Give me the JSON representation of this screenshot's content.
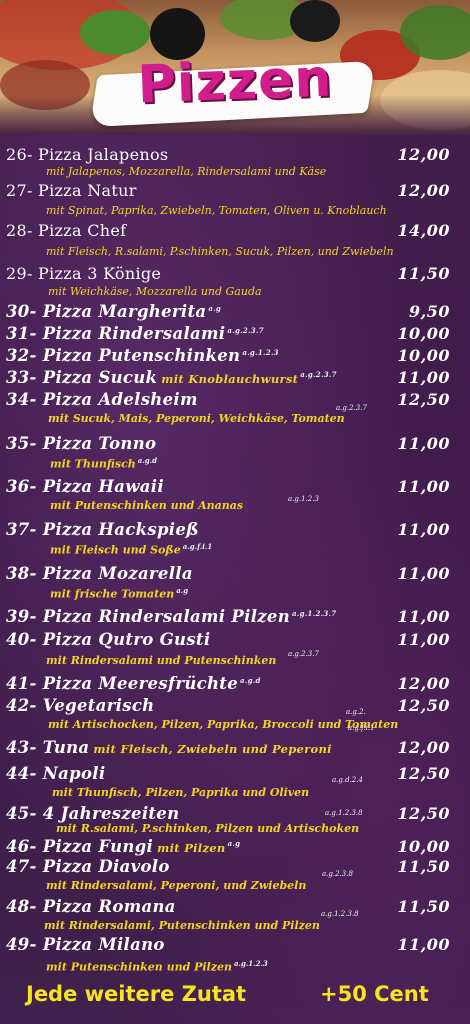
{
  "header": {
    "title": "Pizzen"
  },
  "items": [
    {
      "name": "26- Pizza Jalapenos",
      "price": "12,00",
      "desc": "mit Jalapenos, Mozzarella, Rindersalami und Käse"
    },
    {
      "name": "27- Pizza Natur",
      "price": "12,00",
      "desc": "mit Spinat, Paprika, Zwiebeln, Tomaten, Oliven u. Knoblauch"
    },
    {
      "name": "28- Pizza Chef",
      "price": "14,00",
      "desc": "mit Fleisch, R.salami, P.schinken, Sucuk, Pilzen, und Zwiebeln"
    },
    {
      "name": "29- Pizza 3 Könige",
      "price": "11,50",
      "desc": "mit Weichkäse, Mozzarella und Gauda"
    },
    {
      "name": "30- Pizza Margherita",
      "code": "a.g",
      "price": "9,50"
    },
    {
      "name": "31- Pizza Rindersalami",
      "code": "a.g.2.3.7",
      "price": "10,00"
    },
    {
      "name": "32- Pizza Putenschinken",
      "code": "a.g.1.2.3",
      "price": "10,00"
    },
    {
      "name": "33- Pizza Sucuk",
      "inline": "mit Knoblauchwurst",
      "code": "a.g.2.3.7",
      "price": "11,00"
    },
    {
      "name": "34- Pizza Adelsheim",
      "price": "12,50",
      "code": "a.g.2.3.7",
      "desc": "mit Sucuk, Mais, Peperoni, Weichkäse, Tomaten"
    },
    {
      "name": "35- Pizza Tonno",
      "price": "11,00",
      "desc": "mit Thunfisch",
      "code": "a.g.d"
    },
    {
      "name": "36- Pizza Hawaii",
      "price": "11,00",
      "desc": "mit Putenschinken und Ananas",
      "code": "a.g.1.2.3"
    },
    {
      "name": "37- Pizza Hackspieß",
      "price": "11,00",
      "desc": "mit Fleisch und Soße",
      "code": "a.g.f.i.1"
    },
    {
      "name": "38- Pizza Mozarella",
      "price": "11,00",
      "desc": "mit frische Tomaten",
      "code": "a.g"
    },
    {
      "name": "39- Pizza Rindersalami Pilzen",
      "code": "a.g.1.2.3.7",
      "price": "11,00"
    },
    {
      "name": "40- Pizza Qutro Gusti",
      "price": "11,00",
      "desc": "mit Rindersalami und Putenschinken",
      "code": "a.g.2.3.7"
    },
    {
      "name": "41- Pizza Meeresfrüchte",
      "code": "a.g.d",
      "price": "12,00"
    },
    {
      "name": "42- Vegetarisch",
      "price": "12,50",
      "code": "a.g.2.",
      "desc": "mit Artischocken, Pilzen, Paprika, Broccoli und Tomaten",
      "code2": "a.g.f.i.1"
    },
    {
      "name": "43- Tuna",
      "inline": "mit Fleisch, Zwiebeln und Peperoni",
      "price": "12,00"
    },
    {
      "name": "44- Napoli",
      "price": "12,50",
      "code": "a.g.d.2.4",
      "desc": "mit Thunfisch, Pilzen, Paprika und Oliven"
    },
    {
      "name": "45- 4 Jahreszeiten",
      "code": "a.g.1.2.3.8",
      "price": "12,50",
      "desc": "mit R.salami, P.schinken, Pilzen und Artischoken"
    },
    {
      "name": "46- Pizza Fungi",
      "inline": "mit Pilzen",
      "code": "a.g",
      "price": "10,00"
    },
    {
      "name": "47- Pizza Diavolo",
      "price": "11,50",
      "code": "a.g.2.3.8",
      "desc": "mit Rindersalami, Peperoni, und Zwiebeln"
    },
    {
      "name": "48- Pizza Romana",
      "price": "11,50",
      "code": "a.g.1.2.3.8",
      "desc": "mit Rindersalami, Putenschinken und Pilzen"
    },
    {
      "name": "49- Pizza Milano",
      "price": "11,00",
      "desc": "mit Putenschinken und Pilzen",
      "code": "a.g.1.2.3"
    }
  ],
  "footer": {
    "extra_label": "Jede weitere Zutat",
    "extra_price": "+50 Cent"
  }
}
